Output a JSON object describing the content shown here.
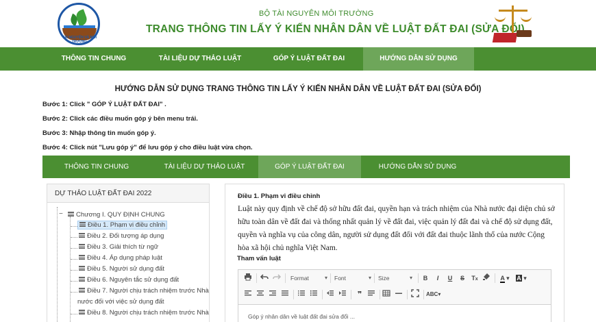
{
  "header": {
    "logo_text": "TÀI NGUYÊN VÀ MÔI TRƯỜNG",
    "ministry": "BỘ TÀI NGUYÊN MÔI TRƯỜNG",
    "title": "TRANG THÔNG TIN LẤY Ý KIẾN NHÂN DÂN VỀ LUẬT ĐẤT ĐAI (SỬA ĐỔI)"
  },
  "nav_top": [
    {
      "label": "THÔNG TIN CHUNG",
      "active": false
    },
    {
      "label": "TÀI LIỆU DỰ THẢO LUẬT",
      "active": false
    },
    {
      "label": "GÓP Ý LUẬT ĐẤT ĐAI",
      "active": false
    },
    {
      "label": "HƯỚNG DẪN SỬ DỤNG",
      "active": true
    }
  ],
  "guide": {
    "title": "HƯỚNG DẪN SỬ DỤNG TRANG THÔNG TIN LẤY Ý KIẾN NHÂN DÂN VỀ LUẬT ĐẤT ĐAI (SỬA ĐỔI)",
    "steps": [
      "Bước 1: Click \" GÓP Ý LUẬT ĐẤT ĐAI\" .",
      "Bước 2: Click các điều muốn góp ý  bên menu trái.",
      "Bước 3: Nhập thông tin muốn góp ý.",
      "Bước 4: Click nút \"Lưu góp ý\" để lưu góp ý cho điều luật vừa chọn."
    ]
  },
  "nav_second": [
    {
      "label": "THÔNG TIN CHUNG",
      "active": false
    },
    {
      "label": "TÀI LIỆU DỰ THẢO LUẬT",
      "active": false
    },
    {
      "label": "GÓP Ý LUẬT ĐẤT ĐAI",
      "active": true
    },
    {
      "label": "HƯỚNG DẪN SỬ DỤNG",
      "active": false
    }
  ],
  "tree": {
    "title": "DỰ THẢO LUẬT ĐẤT ĐAI 2022",
    "chapter": "Chương I. QUY ĐỊNH CHUNG",
    "articles": [
      "Điều 1. Phạm vi điều chỉnh",
      "Điều 2. Đối tượng áp dụng",
      "Điều 3. Giải thích từ ngữ",
      "Điều 4. Áp dụng pháp luật",
      "Điều 5. Người sử dụng đất",
      "Điều 6. Nguyên tắc sử dụng đất",
      "Điều 7. Người chịu trách nhiệm trước Nhà",
      "nước đối với việc sử dụng đất",
      "Điều 8. Người chịu trách nhiệm trước Nhà"
    ],
    "selected_index": 0
  },
  "article": {
    "title": "Điều 1. Phạm vi điều chỉnh",
    "body": "Luật này quy định về chế độ sở hữu đất đai, quyền hạn và trách nhiệm của Nhà nước đại diện chủ sở hữu toàn dân về đất đai và thống nhất quản lý về đất đai, việc quản lý đất đai và chế độ sử dụng đất, quyền và nghĩa vụ của công dân, người sử dụng đất đối với đất đai thuộc lãnh thổ của nước Cộng hòa xã hội chủ nghĩa Việt Nam."
  },
  "consult": {
    "label": "Tham vấn luật"
  },
  "editor": {
    "format_label": "Format",
    "font_label": "Font",
    "size_label": "Size",
    "placeholder": "Góp ý nhân dân về luật đất đai sửa đổi ..."
  },
  "colors": {
    "nav_green": "#4b8f32",
    "nav_active": "#6ea65a",
    "title_green": "#3d8b2c"
  }
}
